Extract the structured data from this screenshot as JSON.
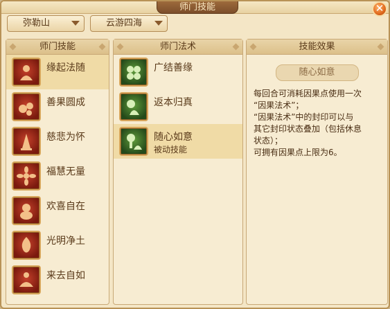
{
  "window": {
    "title": "师门技能"
  },
  "filters": {
    "mountain": "弥勒山",
    "school": "云游四海"
  },
  "school_skills": {
    "header": "师门技能",
    "items": [
      {
        "label": "缘起法随",
        "icon": "monk-icon",
        "selected": true
      },
      {
        "label": "善果圆成",
        "icon": "fruit-icon",
        "selected": false
      },
      {
        "label": "慈悲为怀",
        "icon": "praying-hands-icon",
        "selected": false
      },
      {
        "label": "福慧无量",
        "icon": "lotus-icon",
        "selected": false
      },
      {
        "label": "欢喜自在",
        "icon": "laughing-buddha-icon",
        "selected": false
      },
      {
        "label": "光明净土",
        "icon": "flame-icon",
        "selected": false
      },
      {
        "label": "来去自如",
        "icon": "meditating-figure-icon",
        "selected": false
      }
    ]
  },
  "school_spells": {
    "header": "师门法术",
    "items": [
      {
        "label": "广结善缘",
        "sub": "",
        "icon": "cluster-icon",
        "selected": false
      },
      {
        "label": "返本归真",
        "sub": "",
        "icon": "sun-figure-icon",
        "selected": false
      },
      {
        "label": "随心如意",
        "sub": "被动技能",
        "icon": "tree-figure-icon",
        "selected": true
      }
    ]
  },
  "skill_effect": {
    "header": "技能效果",
    "name": "随心如意",
    "lines": [
      "每回合可消耗因果点使用一次",
      "“因果法术”；",
      "“因果法术”中的封印可以与",
      "其它封印状态叠加（包括休息",
      "状态）；",
      "可拥有因果点上限为6。"
    ]
  },
  "colors": {
    "accent": "#7c4e2a",
    "panel_bg": "#f7ecd2",
    "selected_row": "#f0dba6",
    "close_button": "#e06a1e"
  }
}
